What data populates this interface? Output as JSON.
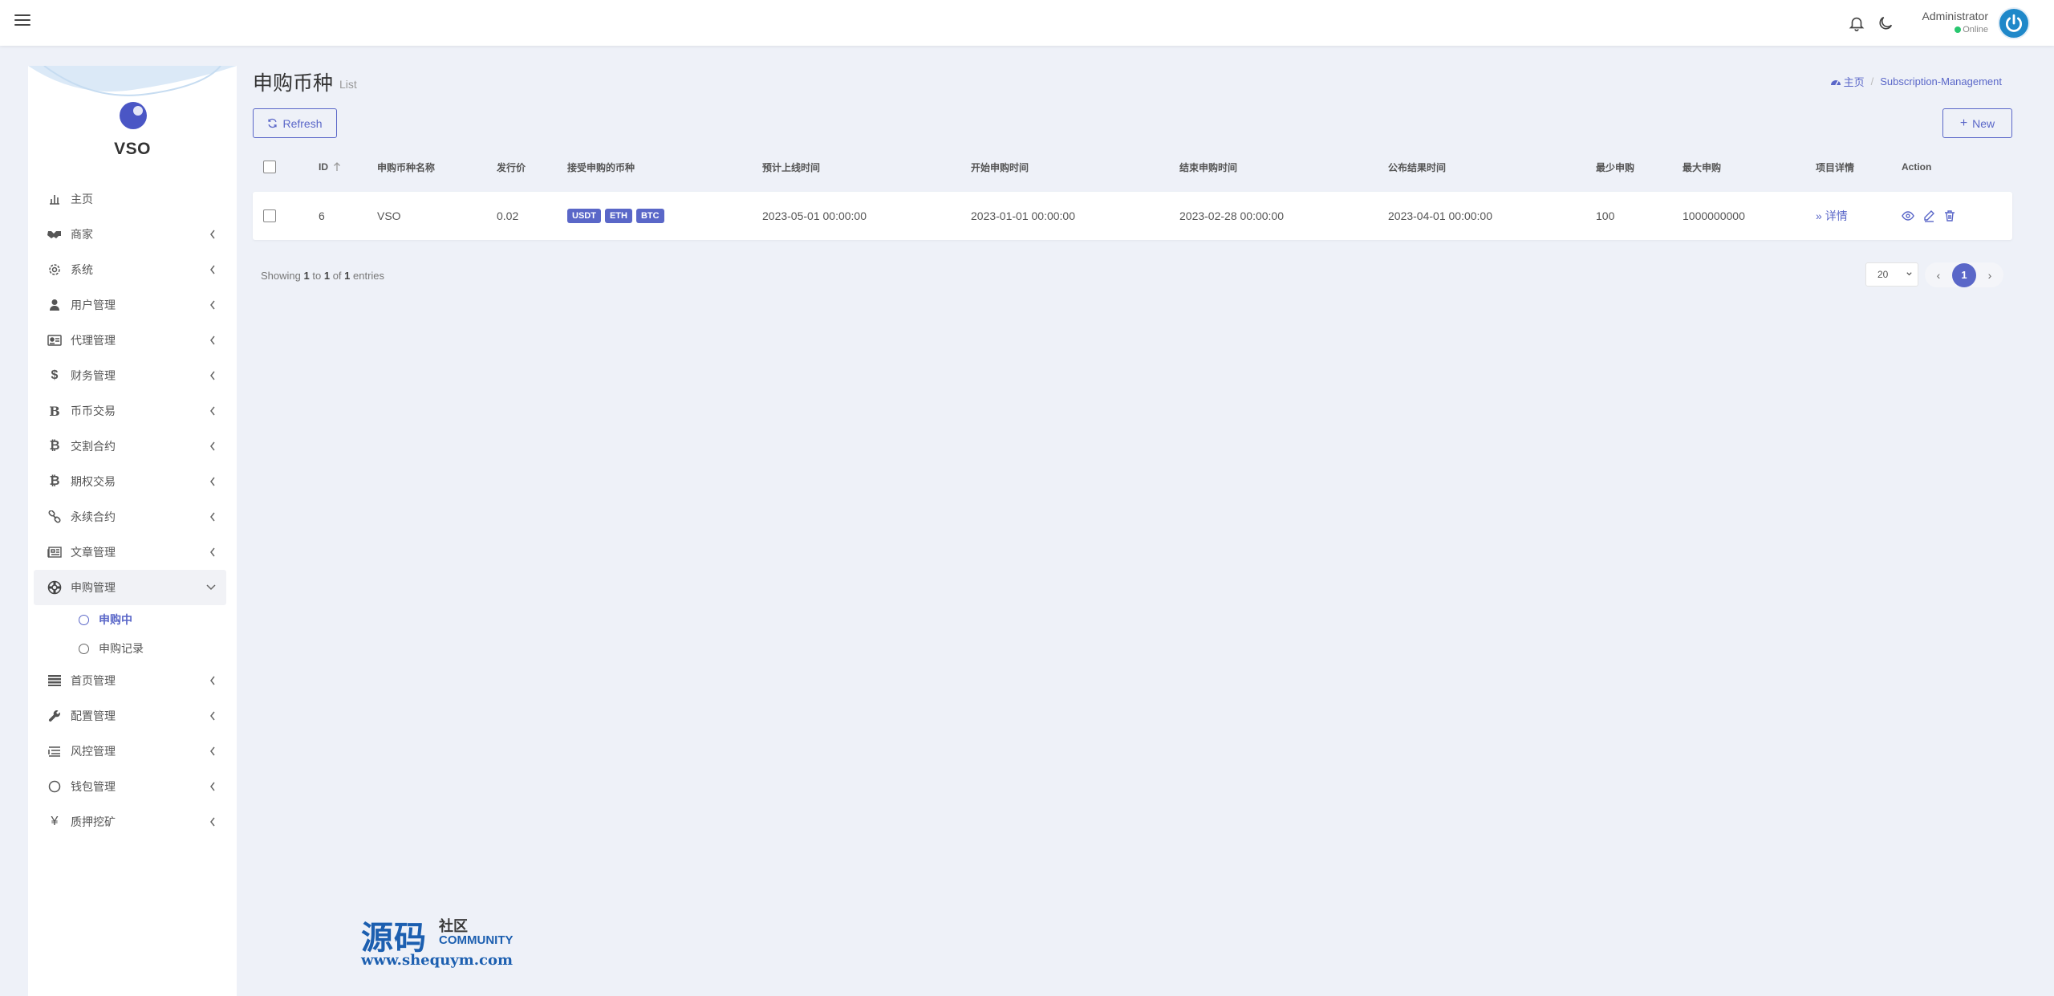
{
  "topbar": {
    "user_name": "Administrator",
    "user_status": "Online"
  },
  "sidebar": {
    "logo_text": "VSO",
    "items": [
      {
        "label": "主页",
        "icon": "chart-icon",
        "has_chevron": false
      },
      {
        "label": "商家",
        "icon": "handshake-icon",
        "has_chevron": true
      },
      {
        "label": "系统",
        "icon": "gear-icon",
        "has_chevron": true
      },
      {
        "label": "用户管理",
        "icon": "user-icon",
        "has_chevron": true
      },
      {
        "label": "代理管理",
        "icon": "id-card-icon",
        "has_chevron": true
      },
      {
        "label": "财务管理",
        "icon": "dollar-icon",
        "has_chevron": true
      },
      {
        "label": "币币交易",
        "icon": "bitcoin-b-icon",
        "has_chevron": true
      },
      {
        "label": "交割合约",
        "icon": "bitcoin-icon",
        "has_chevron": true
      },
      {
        "label": "期权交易",
        "icon": "bitcoin-icon",
        "has_chevron": true
      },
      {
        "label": "永续合约",
        "icon": "link-icon",
        "has_chevron": true
      },
      {
        "label": "文章管理",
        "icon": "newspaper-icon",
        "has_chevron": true
      },
      {
        "label": "申购管理",
        "icon": "lifebuoy-icon",
        "has_chevron": true,
        "expanded": true
      },
      {
        "label": "首页管理",
        "icon": "list-icon",
        "has_chevron": true
      },
      {
        "label": "配置管理",
        "icon": "wrench-icon",
        "has_chevron": true
      },
      {
        "label": "风控管理",
        "icon": "lines-icon",
        "has_chevron": true
      },
      {
        "label": "钱包管理",
        "icon": "circle-icon",
        "has_chevron": true
      },
      {
        "label": "质押挖矿",
        "icon": "yen-icon",
        "has_chevron": true
      }
    ],
    "submenu": [
      {
        "label": "申购中",
        "active": true
      },
      {
        "label": "申购记录",
        "active": false
      }
    ]
  },
  "header": {
    "title": "申购币种",
    "subtitle": "List",
    "breadcrumb_home": "主页",
    "breadcrumb_current": "Subscription-Management"
  },
  "toolbar": {
    "refresh_label": "Refresh",
    "new_label": "New"
  },
  "table": {
    "columns": [
      "ID",
      "申购币种名称",
      "发行价",
      "接受申购的币种",
      "预计上线时间",
      "开始申购时间",
      "结束申购时间",
      "公布结果时间",
      "最少申购",
      "最大申购",
      "项目详情",
      "Action"
    ],
    "rows": [
      {
        "id": "6",
        "name": "VSO",
        "price": "0.02",
        "currencies": [
          "USDT",
          "ETH",
          "BTC"
        ],
        "listing_time": "2023-05-01 00:00:00",
        "start_time": "2023-01-01 00:00:00",
        "end_time": "2023-02-28 00:00:00",
        "result_time": "2023-04-01 00:00:00",
        "min": "100",
        "max": "1000000000",
        "detail_label": "详情"
      }
    ]
  },
  "footer": {
    "showing": "Showing",
    "from": "1",
    "to_word": "to",
    "to": "1",
    "of_word": "of",
    "total": "1",
    "entries": "entries",
    "page_size": "20",
    "current_page": "1"
  },
  "watermark": {
    "big": "源码",
    "small": "社区",
    "community": "COMMUNITY",
    "url": "www.shequym.com"
  },
  "colors": {
    "accent": "#5a67c8",
    "background": "#eef1f8"
  }
}
